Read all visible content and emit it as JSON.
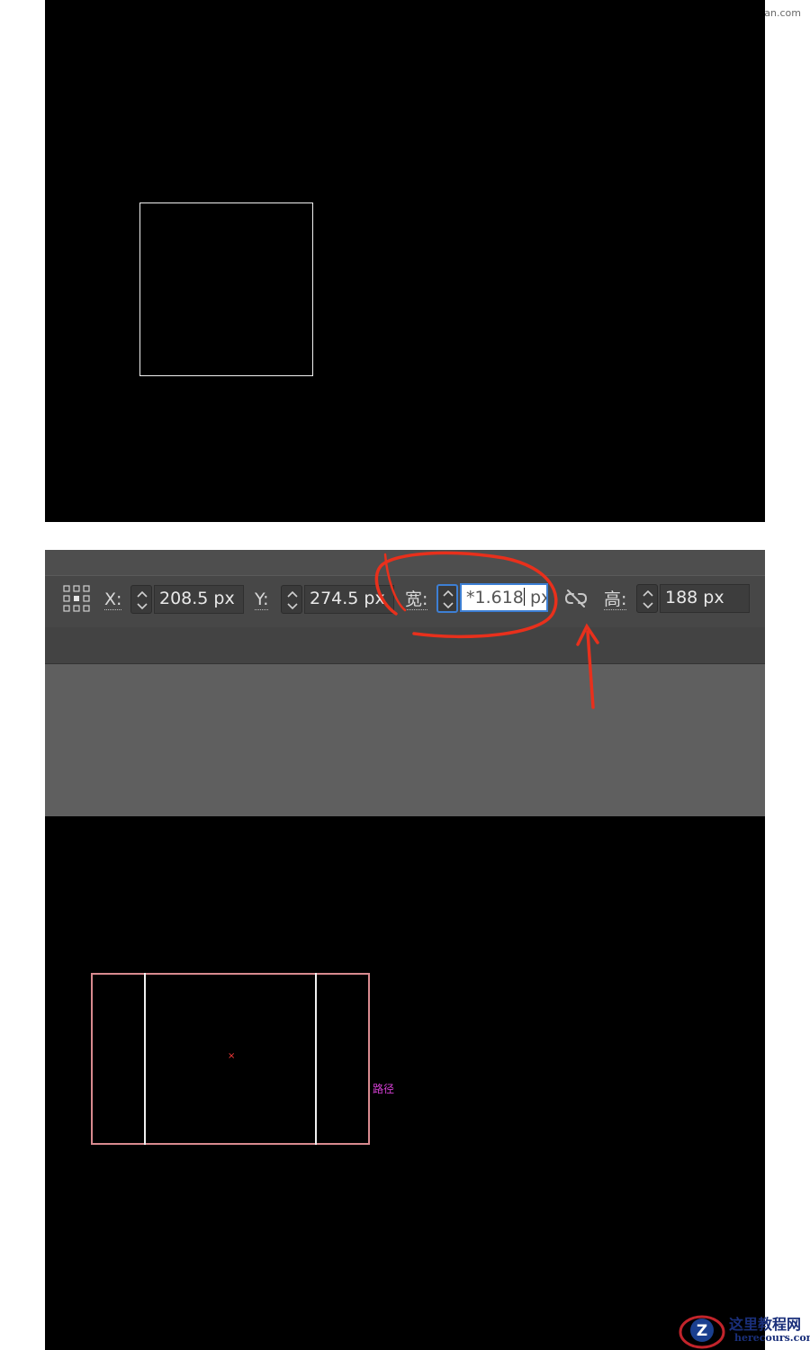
{
  "watermark_top": "思缘设计论坛 www.missyuan.com",
  "toolbar": {
    "x_label": "X:",
    "x_value": "208.5 px",
    "y_label": "Y:",
    "y_value": "274.5 px",
    "w_label": "宽:",
    "w_value_before_caret": "*1.618",
    "w_value_after_caret": " px",
    "h_label": "高:",
    "h_value": "188 px"
  },
  "canvas_bottom": {
    "center_marker": "×",
    "path_label": "路径"
  },
  "logo": {
    "cn": "这里教程网",
    "en": "herecours.com",
    "letter": "Z"
  },
  "colors": {
    "annotation_red": "#e8301c",
    "active_field_border": "#3d7fd4",
    "selection_pink": "#d88a8f",
    "path_label_magenta": "#d43fd4"
  },
  "icons": [
    "transform-reference-grid-icon",
    "stepper-up-down-icon",
    "unlink-chain-icon"
  ]
}
